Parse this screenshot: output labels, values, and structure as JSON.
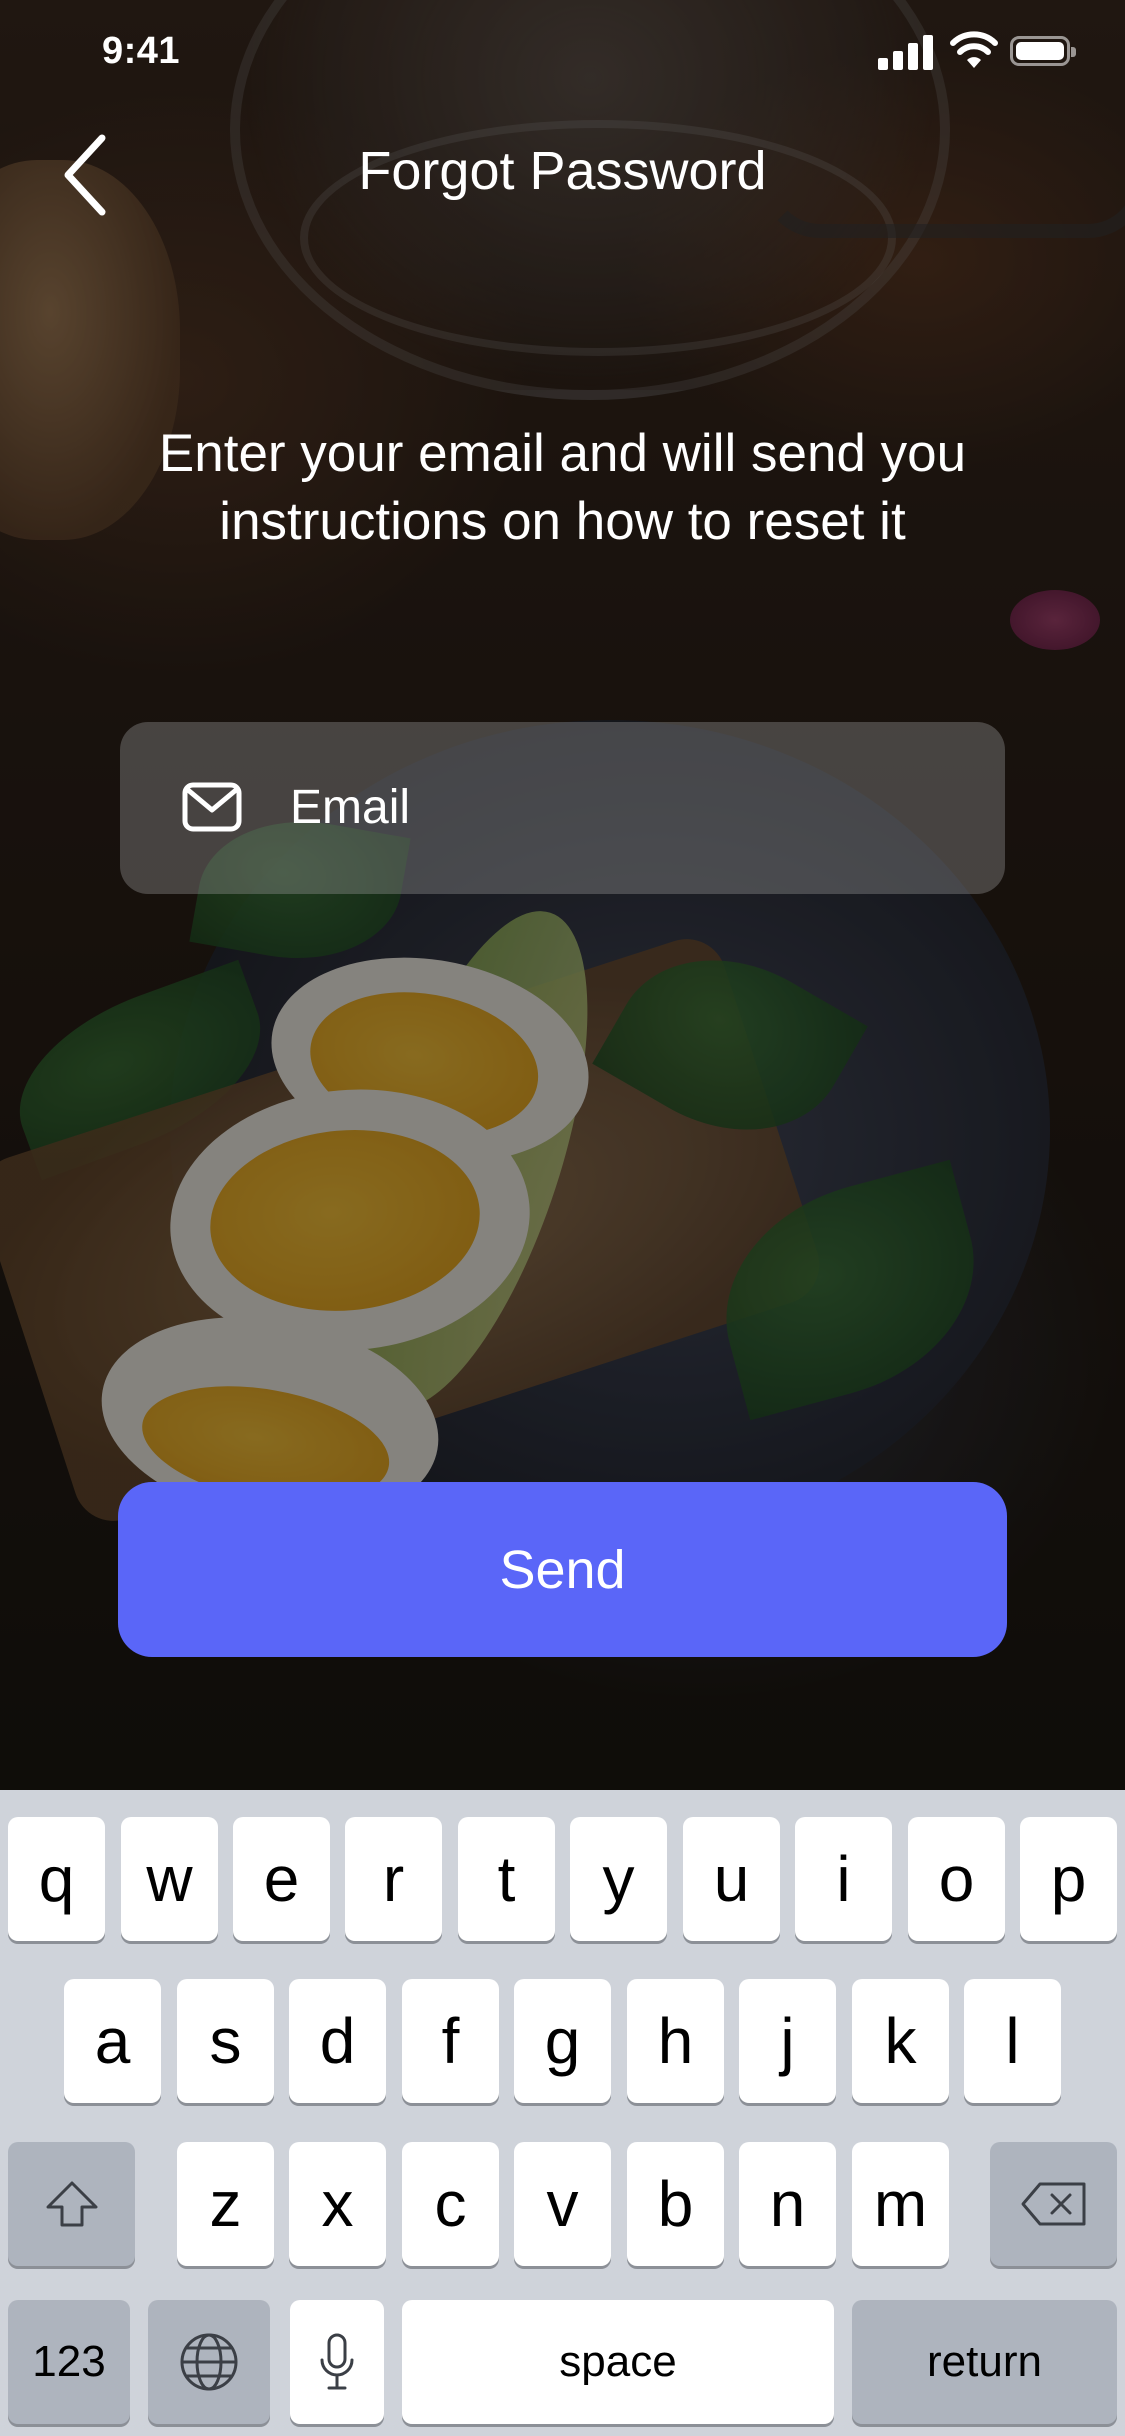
{
  "status_bar": {
    "time": "9:41"
  },
  "header": {
    "title": "Forgot Password"
  },
  "instructions": "Enter your email and will send you instructions on how to reset it",
  "email_field": {
    "placeholder": "Email",
    "value": ""
  },
  "send_button": {
    "label": "Send"
  },
  "keyboard": {
    "row1": [
      "q",
      "w",
      "e",
      "r",
      "t",
      "y",
      "u",
      "i",
      "o",
      "p"
    ],
    "row2": [
      "a",
      "s",
      "d",
      "f",
      "g",
      "h",
      "j",
      "k",
      "l"
    ],
    "row3": [
      "z",
      "x",
      "c",
      "v",
      "b",
      "n",
      "m"
    ],
    "numbers_label": "123",
    "space_label": "space",
    "return_label": "return"
  },
  "colors": {
    "accent": "#5A66F8",
    "keyboard_bg": "#CFD3DA"
  }
}
